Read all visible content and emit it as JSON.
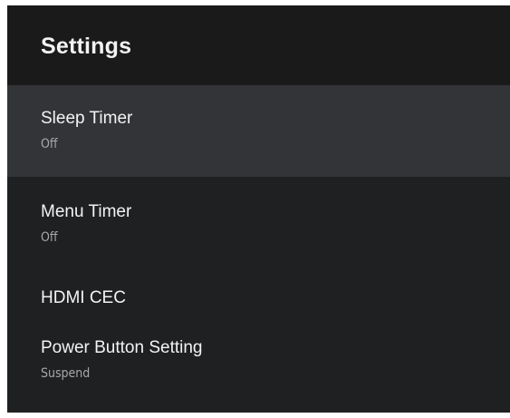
{
  "header": {
    "title": "Settings"
  },
  "items": [
    {
      "label": "Sleep Timer",
      "value": "Off",
      "focused": true
    },
    {
      "label": "Menu Timer",
      "value": "Off"
    },
    {
      "label": "HDMI CEC"
    },
    {
      "label": "Power Button Setting",
      "value": "Suspend"
    }
  ],
  "colors": {
    "panel_bg": "#1f2022",
    "header_bg": "#1a1a1a",
    "focused_bg": "#333437",
    "text_primary": "#f3f3f3",
    "text_secondary": "#a7a7a9"
  }
}
